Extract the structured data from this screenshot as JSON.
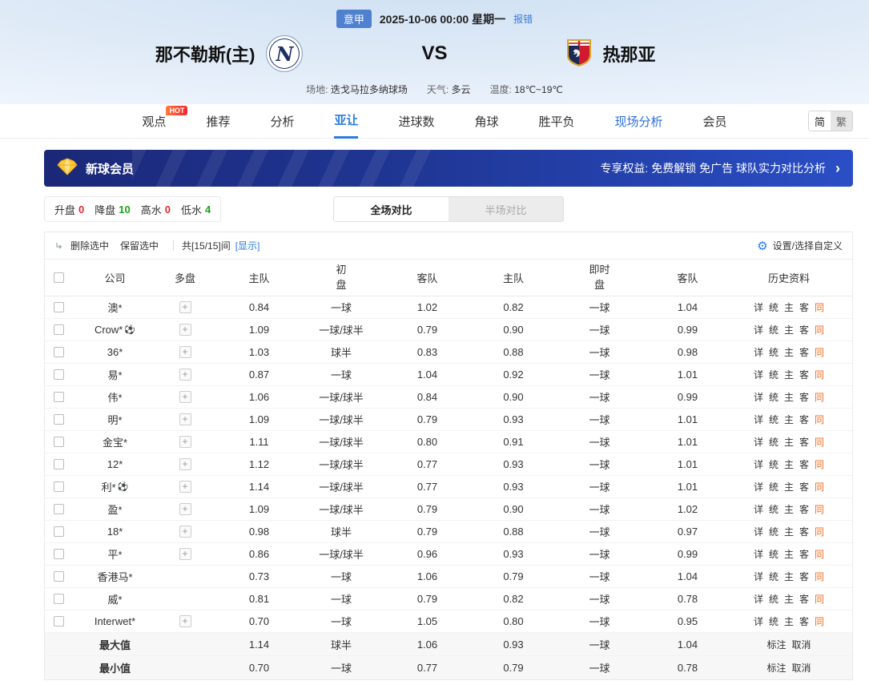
{
  "header": {
    "league_badge": "意甲",
    "datetime": "2025-10-06 00:00 星期一",
    "report_error": "报错",
    "home_team": "那不勒斯(主)",
    "home_logo_letter": "N",
    "vs": "VS",
    "away_team": "热那亚",
    "info": {
      "venue_label": "场地:",
      "venue": "迭戈马拉多纳球场",
      "weather_label": "天气:",
      "weather": "多云",
      "temp_label": "温度:",
      "temp": "18℃~19℃"
    }
  },
  "nav": {
    "items": [
      {
        "label": "观点",
        "badge": "HOT"
      },
      {
        "label": "推荐"
      },
      {
        "label": "分析"
      },
      {
        "label": "亚让",
        "active": true
      },
      {
        "label": "进球数"
      },
      {
        "label": "角球"
      },
      {
        "label": "胜平负"
      },
      {
        "label": "现场分析",
        "highlight": true
      },
      {
        "label": "会员"
      }
    ],
    "lang": [
      {
        "label": "简",
        "active": true
      },
      {
        "label": "繁",
        "active": false
      }
    ]
  },
  "banner": {
    "title": "新球会员",
    "benefits": "专享权益: 免费解锁 免广告 球队实力对比分析",
    "arrow": "›"
  },
  "filters": {
    "stats": [
      {
        "label": "升盘",
        "value": "0",
        "color": "#e22b2b"
      },
      {
        "label": "降盘",
        "value": "10",
        "color": "#18a318"
      },
      {
        "label": "高水",
        "value": "0",
        "color": "#e22b2b"
      },
      {
        "label": "低水",
        "value": "4",
        "color": "#18a318"
      }
    ],
    "tabs": [
      {
        "label": "全场对比",
        "active": true
      },
      {
        "label": "半场对比",
        "active": false
      }
    ]
  },
  "toolbar": {
    "delete_selected": "删除选中",
    "keep_selected": "保留选中",
    "count_text": "共[15/15]间",
    "show_link": "[显示]",
    "settings_label": "设置/选择自定义"
  },
  "table": {
    "headers": {
      "company": "公司",
      "multi": "多盘",
      "home": "主队",
      "away": "客队",
      "initial_top": "初",
      "initial_bottom": "盘",
      "live_top": "即时",
      "live_bottom": "盘",
      "history": "历史资料"
    },
    "history_links": [
      {
        "label": "详"
      },
      {
        "label": "统"
      },
      {
        "label": "主"
      },
      {
        "label": "客"
      },
      {
        "label": "同",
        "highlight": true
      }
    ],
    "rows": [
      {
        "company": "澳*",
        "multi": true,
        "init_home": "0.84",
        "init_handicap": "一球",
        "init_away": "1.02",
        "live_home": "0.82",
        "live_handicap": "一球",
        "live_away": "1.04"
      },
      {
        "company": "Crow*",
        "ball": true,
        "multi": true,
        "init_home": "1.09",
        "init_handicap": "一球/球半",
        "init_away": "0.79",
        "live_home": "0.90",
        "live_handicap": "一球",
        "live_away": "0.99"
      },
      {
        "company": "36*",
        "multi": true,
        "init_home": "1.03",
        "init_handicap": "球半",
        "init_away": "0.83",
        "live_home": "0.88",
        "live_handicap": "一球",
        "live_away": "0.98"
      },
      {
        "company": "易*",
        "multi": true,
        "init_home": "0.87",
        "init_handicap": "一球",
        "init_away": "1.04",
        "live_home": "0.92",
        "live_handicap": "一球",
        "live_away": "1.01"
      },
      {
        "company": "伟*",
        "multi": true,
        "init_home": "1.06",
        "init_handicap": "一球/球半",
        "init_away": "0.84",
        "live_home": "0.90",
        "live_handicap": "一球",
        "live_away": "0.99"
      },
      {
        "company": "明*",
        "multi": true,
        "init_home": "1.09",
        "init_handicap": "一球/球半",
        "init_away": "0.79",
        "live_home": "0.93",
        "live_handicap": "一球",
        "live_away": "1.01"
      },
      {
        "company": "金宝*",
        "multi": true,
        "init_home": "1.11",
        "init_handicap": "一球/球半",
        "init_away": "0.80",
        "live_home": "0.91",
        "live_handicap": "一球",
        "live_away": "1.01"
      },
      {
        "company": "12*",
        "multi": true,
        "init_home": "1.12",
        "init_handicap": "一球/球半",
        "init_away": "0.77",
        "live_home": "0.93",
        "live_handicap": "一球",
        "live_away": "1.01"
      },
      {
        "company": "利*",
        "ball": true,
        "multi": true,
        "init_home": "1.14",
        "init_handicap": "一球/球半",
        "init_away": "0.77",
        "live_home": "0.93",
        "live_handicap": "一球",
        "live_away": "1.01"
      },
      {
        "company": "盈*",
        "multi": true,
        "init_home": "1.09",
        "init_handicap": "一球/球半",
        "init_away": "0.79",
        "live_home": "0.90",
        "live_handicap": "一球",
        "live_away": "1.02"
      },
      {
        "company": "18*",
        "multi": true,
        "init_home": "0.98",
        "init_handicap": "球半",
        "init_away": "0.79",
        "live_home": "0.88",
        "live_handicap": "一球",
        "live_away": "0.97"
      },
      {
        "company": "平*",
        "multi": true,
        "init_home": "0.86",
        "init_handicap": "一球/球半",
        "init_away": "0.96",
        "live_home": "0.93",
        "live_handicap": "一球",
        "live_away": "0.99"
      },
      {
        "company": "香港马*",
        "multi": false,
        "init_home": "0.73",
        "init_handicap": "一球",
        "init_away": "1.06",
        "live_home": "0.79",
        "live_handicap": "一球",
        "live_away": "1.04"
      },
      {
        "company": "威*",
        "multi": false,
        "init_home": "0.81",
        "init_handicap": "一球",
        "init_away": "0.79",
        "live_home": "0.82",
        "live_handicap": "一球",
        "live_away": "0.78"
      },
      {
        "company": "Interwet*",
        "multi": true,
        "init_home": "0.70",
        "init_handicap": "一球",
        "init_away": "1.05",
        "live_home": "0.80",
        "live_handicap": "一球",
        "live_away": "0.95"
      }
    ],
    "summary_rows": [
      {
        "label": "最大值",
        "init_home": "1.14",
        "init_handicap": "球半",
        "init_away": "1.06",
        "live_home": "0.93",
        "live_handicap": "一球",
        "live_away": "1.04",
        "actions": [
          "标注",
          "取消"
        ]
      },
      {
        "label": "最小值",
        "init_home": "0.70",
        "init_handicap": "一球",
        "init_away": "0.77",
        "live_home": "0.79",
        "live_handicap": "一球",
        "live_away": "0.78",
        "actions": [
          "标注",
          "取消"
        ]
      }
    ]
  }
}
